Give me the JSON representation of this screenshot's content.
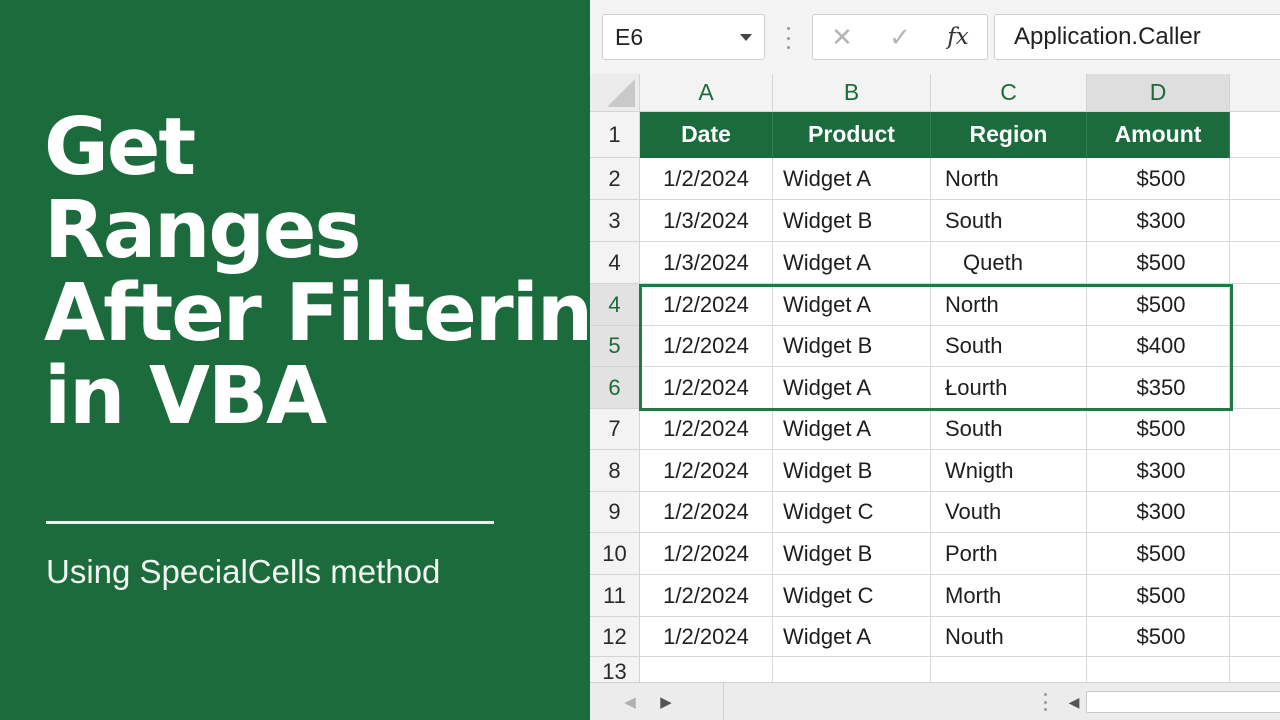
{
  "title": {
    "lines": [
      "Get",
      "Ranges",
      "After Filtering",
      "in VBA"
    ],
    "subtitle": "Using SpecialCells method"
  },
  "formula_bar": {
    "name_box": "E6",
    "cancel_symbol": "✕",
    "enter_symbol": "✓",
    "fx_label": "fx",
    "formula": "Application.Caller"
  },
  "colors": {
    "brand_green": "#1b6b3c",
    "selection_border": "#1f7a45"
  },
  "columns": [
    "A",
    "B",
    "C",
    "D"
  ],
  "selected_column": "D",
  "header_row": {
    "row_number": "1",
    "cells": [
      "Date",
      "Product",
      "Region",
      "Amount"
    ]
  },
  "rows": [
    {
      "num": "2",
      "cells": [
        "1/2/2024",
        "Widget A",
        "North",
        "$500"
      ]
    },
    {
      "num": "3",
      "cells": [
        "1/3/2024",
        "Widget B",
        "South",
        "$300"
      ]
    },
    {
      "num": "4",
      "cells": [
        "1/3/2024",
        "Widget A",
        "Queth",
        "$500"
      ]
    },
    {
      "num": "4",
      "cells": [
        "1/2/2024",
        "Widget A",
        "North",
        "$500"
      ],
      "selected": true
    },
    {
      "num": "5",
      "cells": [
        "1/2/2024",
        "Widget B",
        "South",
        "$400"
      ],
      "selected": true
    },
    {
      "num": "6",
      "cells": [
        "1/2/2024",
        "Widget A",
        "Łourth",
        "$350"
      ],
      "selected": true
    },
    {
      "num": "7",
      "cells": [
        "1/2/2024",
        "Widget A",
        "South",
        "$500"
      ]
    },
    {
      "num": "8",
      "cells": [
        "1/2/2024",
        "Widget B",
        "Wnigth",
        "$300"
      ]
    },
    {
      "num": "9",
      "cells": [
        "1/2/2024",
        "Widget C",
        "Vouth",
        "$300"
      ]
    },
    {
      "num": "10",
      "cells": [
        "1/2/2024",
        "Widget B",
        "Porth",
        "$500"
      ]
    },
    {
      "num": "11",
      "cells": [
        "1/2/2024",
        "Widget C",
        "Morth",
        "$500"
      ]
    },
    {
      "num": "12",
      "cells": [
        "1/2/2024",
        "Widget A",
        "Nouth",
        "$500"
      ]
    },
    {
      "num": "13",
      "cells": [
        "",
        "",
        "",
        ""
      ]
    }
  ],
  "icons": {
    "prev_sheet": "◀",
    "next_sheet": "▶",
    "scroll_left": "◀"
  }
}
